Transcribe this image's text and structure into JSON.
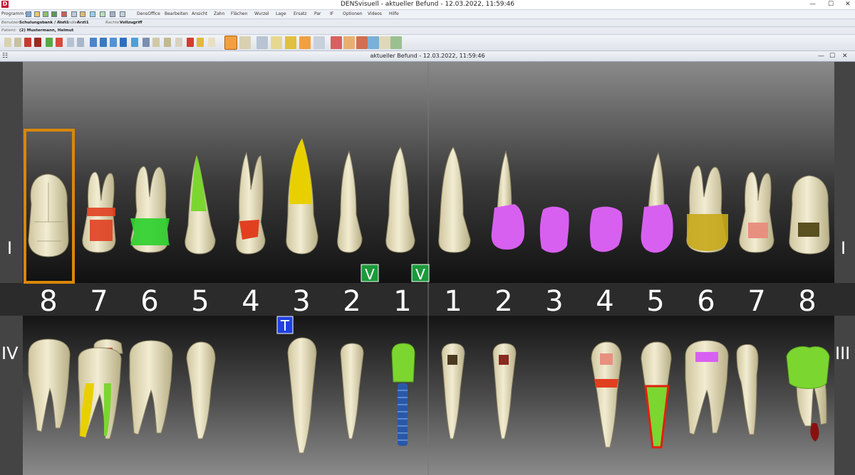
{
  "window": {
    "title": "DENSvisuell -  aktueller Befund - 12.03.2022, 11:59:46",
    "minimize": "—",
    "maximize": "☐",
    "close": "✕"
  },
  "menu": {
    "programm": "Programm",
    "items": [
      "DensOffice",
      "Bearbeiten",
      "Ansicht",
      "Zahn",
      "Flächen",
      "Wurzel",
      "Lage",
      "Ersatz",
      "Par",
      "IF",
      "Optionen",
      "Videos",
      "Hilfe"
    ]
  },
  "info": {
    "benutzer_label": "Benutzer:",
    "benutzer": "Schulungsbank / Arzt1",
    "behandler_label": "Behandler:",
    "behandler": "Arzt1",
    "rechte_label": "Rechte:",
    "rechte": "Vollzugriff",
    "patient_label": "Patient:",
    "patient": "(2) Mustermann, Helmut"
  },
  "document": {
    "title": "aktueller Befund - 12.03.2022, 11:59:46"
  },
  "colors": {
    "background": "#2a2a2a",
    "tooth": "#e8e0bf",
    "selection": "#d9870c",
    "green": "#2fd02f",
    "red": "#e04020",
    "violet": "#d860f0",
    "yellow": "#e8d000",
    "lightgreen": "#7cd630"
  },
  "chart": {
    "quadrant_labels": {
      "upper_left": "I",
      "upper_right": "I",
      "lower_left": "IV",
      "lower_right": "III"
    },
    "tooth_numbers": [
      "8",
      "7",
      "6",
      "5",
      "4",
      "3",
      "2",
      "1",
      "1",
      "2",
      "3",
      "4",
      "5",
      "6",
      "7",
      "8"
    ],
    "markers": [
      {
        "label": "V",
        "tooth": "upper-2"
      },
      {
        "label": "V",
        "tooth": "upper-1"
      },
      {
        "label": "T",
        "tooth": "lower-3"
      }
    ]
  }
}
